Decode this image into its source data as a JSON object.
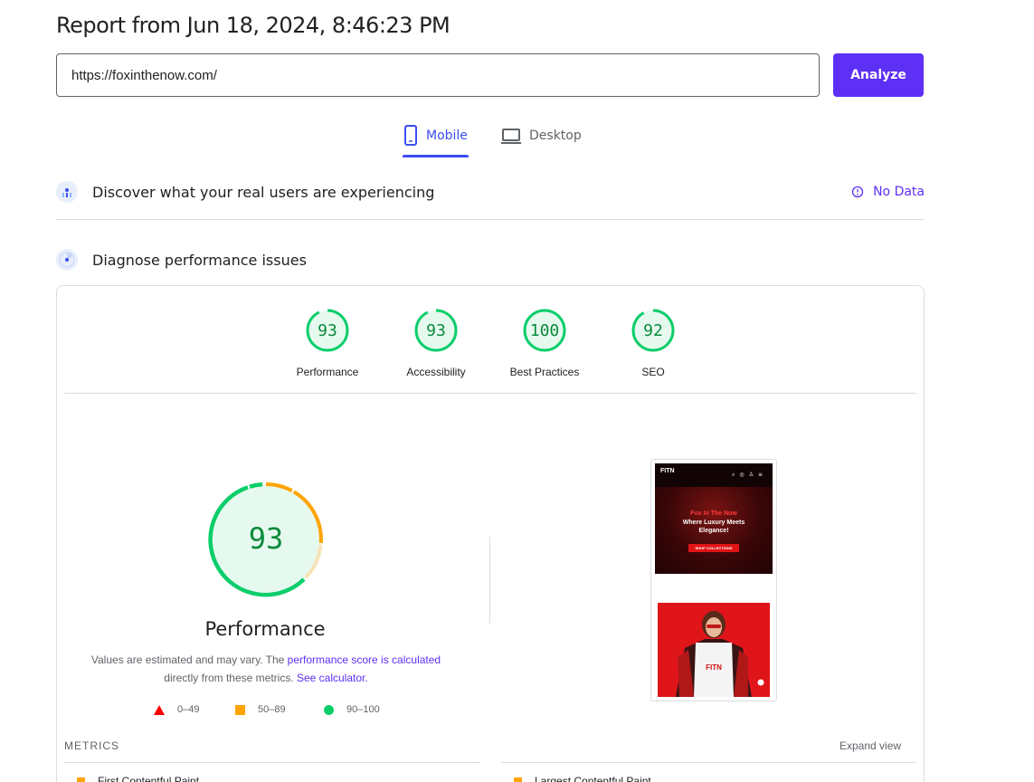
{
  "report": {
    "title": "Report from Jun 18, 2024, 8:46:23 PM"
  },
  "search": {
    "url": "https://foxinthenow.com/",
    "analyze_label": "Analyze"
  },
  "tabs": [
    {
      "label": "Mobile",
      "icon": "phone-icon",
      "active": true
    },
    {
      "label": "Desktop",
      "icon": "laptop-icon",
      "active": false
    }
  ],
  "field_data": {
    "title": "Discover what your real users are experiencing",
    "status": "No Data"
  },
  "diagnose": {
    "title": "Diagnose performance issues"
  },
  "scores": [
    {
      "label": "Performance",
      "value": "93"
    },
    {
      "label": "Accessibility",
      "value": "93"
    },
    {
      "label": "Best Practices",
      "value": "100"
    },
    {
      "label": "SEO",
      "value": "92"
    }
  ],
  "performance": {
    "score": "93",
    "title": "Performance",
    "note_prefix": "Values are estimated and may vary. The ",
    "note_link1": "performance score is calculated",
    "note_mid": "directly from these metrics. ",
    "note_link2": "See calculator."
  },
  "legend": [
    {
      "range": "0–49",
      "color": "#ff0000"
    },
    {
      "range": "50–89",
      "color": "#ffa400"
    },
    {
      "range": "90–100",
      "color": "#0cce6b"
    }
  ],
  "screenshot": {
    "logo": "FITN",
    "headline": "Fox In The Now",
    "tagline1": "Where Luxury Meets",
    "tagline2": "Elegance!",
    "cta": "SHOP COLLECTIONS",
    "shirt_logo": "FITN"
  },
  "metrics": {
    "label": "METRICS",
    "expand": "Expand view",
    "items": [
      {
        "name": "First Contentful Paint"
      },
      {
        "name": "Largest Contentful Paint"
      }
    ]
  },
  "colors": {
    "accent": "#5e2ff5",
    "tab_active": "#3c4df0",
    "pass": "#0cce6b",
    "average": "#ffa400",
    "fail": "#ff0000"
  }
}
